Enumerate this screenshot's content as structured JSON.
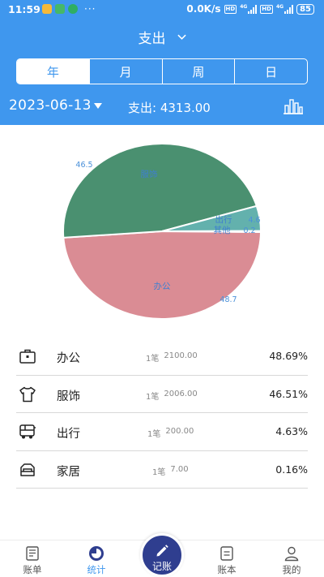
{
  "status_bar": {
    "time": "11:59",
    "network_speed": "0.0K/s",
    "hd1": "HD",
    "net1": "4G",
    "hd2": "HD",
    "net2": "4G",
    "battery": "85",
    "more": "···"
  },
  "header": {
    "title": "支出",
    "tabs": [
      {
        "label": "年",
        "active": true
      },
      {
        "label": "月",
        "active": false
      },
      {
        "label": "周",
        "active": false
      },
      {
        "label": "日",
        "active": false
      }
    ],
    "date": "2023-06-13",
    "total_label": "支出: 4313.00"
  },
  "chart_data": {
    "type": "pie",
    "slices": [
      {
        "label": "办公",
        "value": 48.7,
        "value_label": "48.7",
        "color": "#da8c94"
      },
      {
        "label": "服饰",
        "value": 46.5,
        "value_label": "46.5",
        "color": "#4a9070"
      },
      {
        "label": "出行",
        "value": 4.6,
        "value_label": "4.6",
        "color": "#63b1ad"
      },
      {
        "label": "其他",
        "value": 0.2,
        "value_label": "0.2",
        "color": "#3f97ee"
      }
    ]
  },
  "categories": [
    {
      "icon": "briefcase-icon",
      "name": "办公",
      "count": "1笔",
      "amount": "2100.00",
      "percent": "48.69%"
    },
    {
      "icon": "tshirt-icon",
      "name": "服饰",
      "count": "1笔",
      "amount": "2006.00",
      "percent": "46.51%"
    },
    {
      "icon": "bus-icon",
      "name": "出行",
      "count": "1笔",
      "amount": "200.00",
      "percent": "4.63%"
    },
    {
      "icon": "sofa-icon",
      "name": "家居",
      "count": "1笔",
      "amount": "7.00",
      "percent": "0.16%"
    }
  ],
  "bottom_nav": {
    "items": [
      {
        "label": "账单",
        "icon": "bill-icon"
      },
      {
        "label": "统计",
        "icon": "stats-pie-icon",
        "active": true
      },
      {
        "label": "账本",
        "icon": "ledger-icon"
      },
      {
        "label": "我的",
        "icon": "profile-icon"
      }
    ],
    "record_label": "记账"
  },
  "colors": {
    "primary": "#3f97ee",
    "fab": "#2f3e8f"
  }
}
